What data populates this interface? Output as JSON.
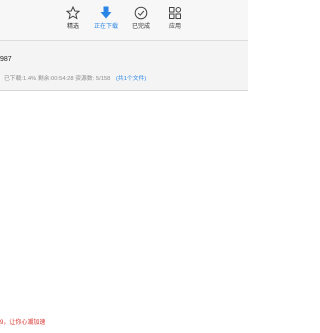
{
  "tabs": [
    {
      "label": "精选",
      "icon": "star-icon"
    },
    {
      "label": "正在下载",
      "icon": "download-arrow-icon"
    },
    {
      "label": "已完成",
      "icon": "check-circle-icon"
    },
    {
      "label": "应用",
      "icon": "apps-grid-icon"
    }
  ],
  "active_tab": "正在下载",
  "accent_color": "#2a86e6",
  "download": {
    "name": "987",
    "downloaded": "已下载:1.4%",
    "remaining": "剩余:00:54:28",
    "sources": "资源数: 5/158",
    "files": "(共1个文件)"
  },
  "tip": "9，让你心潮加速"
}
